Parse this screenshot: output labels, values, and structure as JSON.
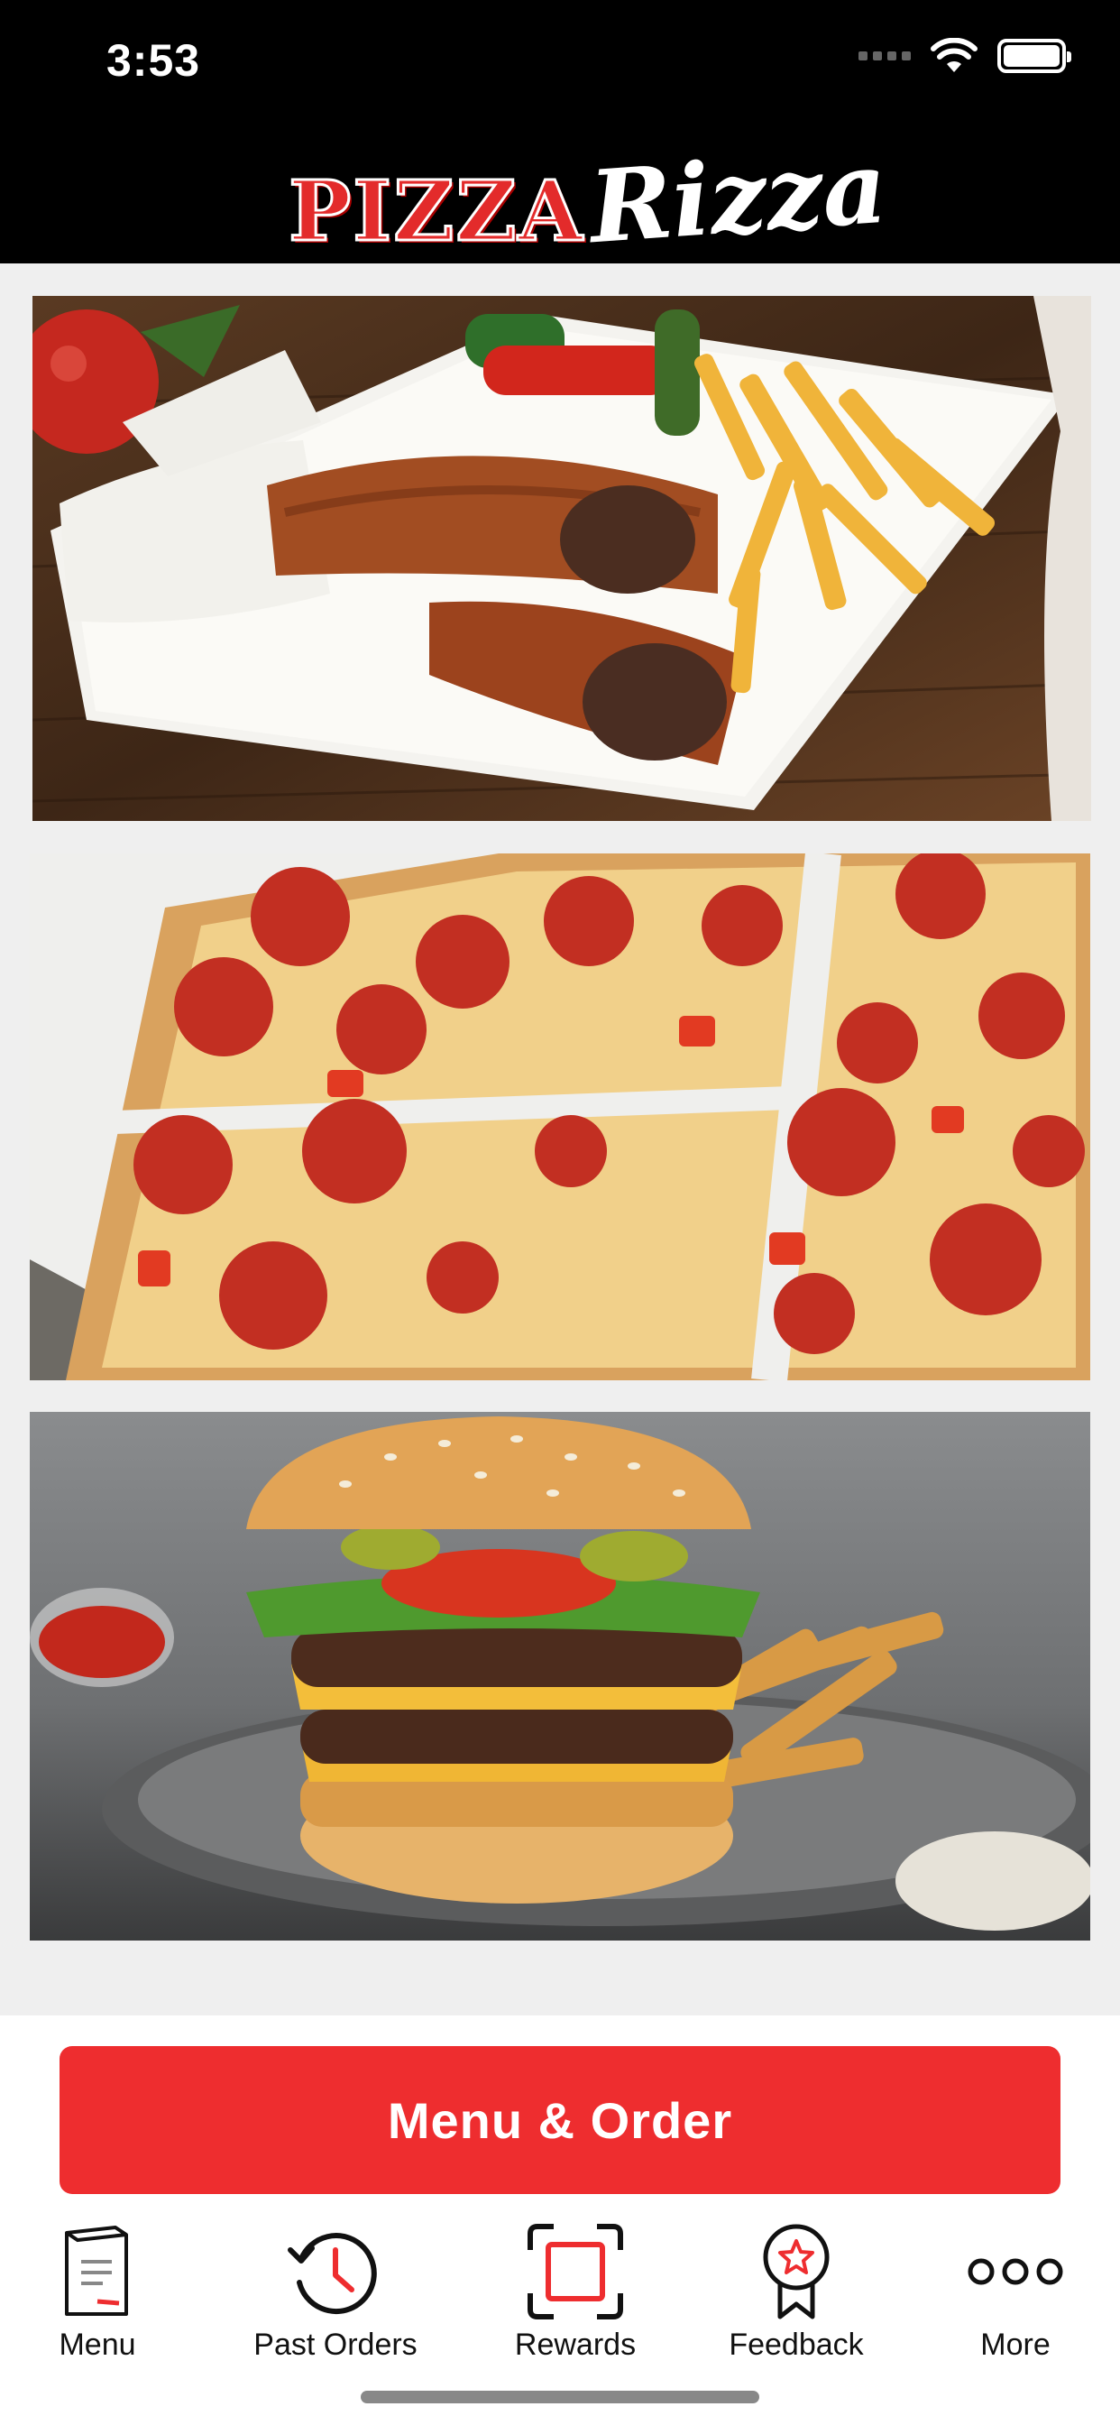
{
  "status_bar": {
    "time": "3:53"
  },
  "brand": {
    "logo_part1": "PIZZA",
    "logo_part2": "Rizza",
    "accent_color": "#ee2d2f"
  },
  "cards": [
    {
      "name": "wrap-and-fries"
    },
    {
      "name": "pepperoni-pizza"
    },
    {
      "name": "double-cheeseburger"
    }
  ],
  "cta": {
    "label": "Menu & Order"
  },
  "tabbar": {
    "items": [
      {
        "label": "Menu",
        "icon": "menu-book-icon"
      },
      {
        "label": "Past Orders",
        "icon": "history-clock-icon"
      },
      {
        "label": "Rewards",
        "icon": "scan-frame-icon"
      },
      {
        "label": "Feedback",
        "icon": "award-star-icon"
      },
      {
        "label": "More",
        "icon": "more-dots-icon"
      }
    ]
  }
}
